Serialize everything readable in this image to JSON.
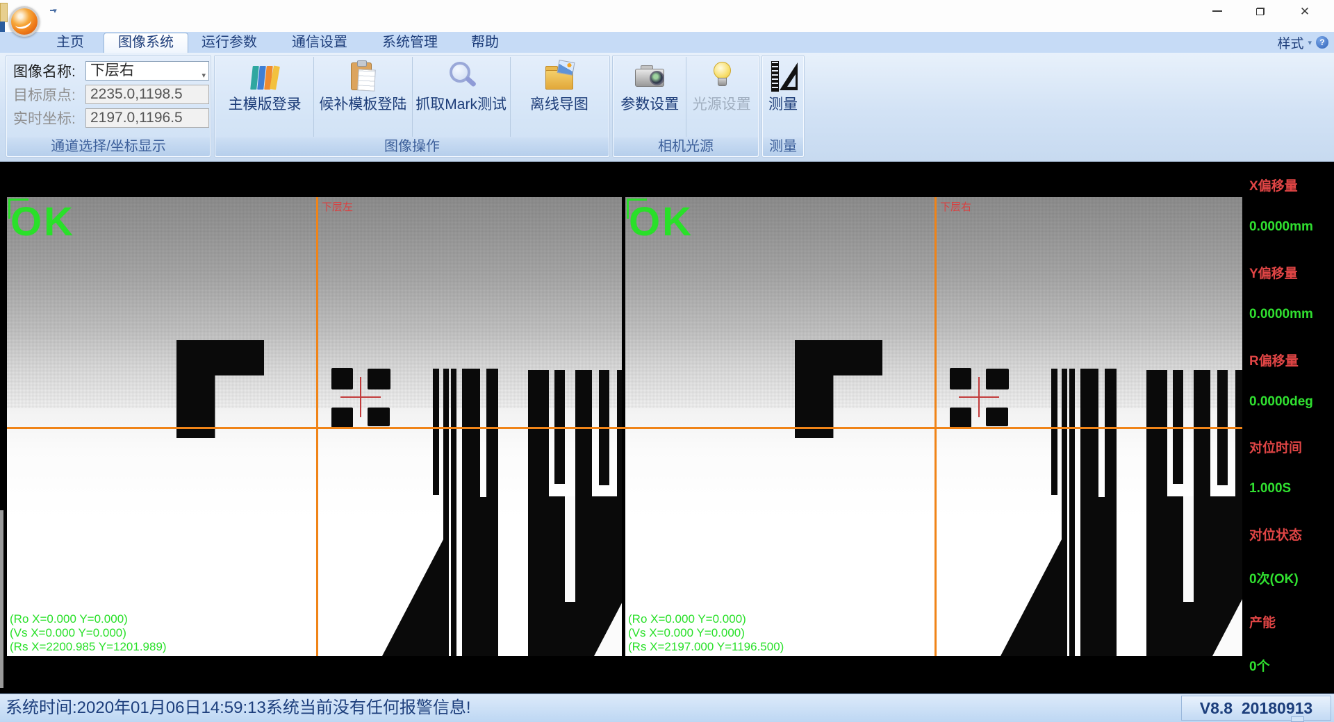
{
  "window": {
    "controls": {
      "close_glyph": "✕"
    }
  },
  "icons": {
    "dropdown": "▾",
    "help": "?"
  },
  "menu": {
    "tabs": [
      {
        "label": "主页",
        "active": false
      },
      {
        "label": "图像系统",
        "active": true
      },
      {
        "label": "运行参数",
        "active": false
      },
      {
        "label": "通信设置",
        "active": false
      },
      {
        "label": "系统管理",
        "active": false
      },
      {
        "label": "帮助",
        "active": false
      }
    ],
    "style_label": "样式"
  },
  "ribbon": {
    "channel": {
      "caption": "通道选择/坐标显示",
      "image_name_label": "图像名称:",
      "image_name_value": "下层右",
      "target_origin_label": "目标原点:",
      "target_origin_value": "2235.0,1198.5",
      "realtime_label": "实时坐标:",
      "realtime_value": "2197.0,1196.5"
    },
    "image_ops": {
      "caption": "图像操作",
      "buttons": [
        {
          "label": "主模版登录"
        },
        {
          "label": "候补模板登陆"
        },
        {
          "label": "抓取Mark测试"
        },
        {
          "label": "离线导图"
        }
      ]
    },
    "camera_light": {
      "caption": "相机光源",
      "buttons": [
        {
          "label": "参数设置",
          "disabled": false
        },
        {
          "label": "光源设置",
          "disabled": true
        }
      ]
    },
    "measure": {
      "caption": "测量",
      "buttons": [
        {
          "label": "测量"
        }
      ]
    }
  },
  "viewports": [
    {
      "result": "OK",
      "name": "下层左",
      "lines": [
        "(Ro X=0.000 Y=0.000)",
        "(Vs X=0.000 Y=0.000)",
        "(Rs X=2200.985 Y=1201.989)"
      ]
    },
    {
      "result": "OK",
      "name": "下层右",
      "lines": [
        "(Ro X=0.000 Y=0.000)",
        "(Vs X=0.000 Y=0.000)",
        "(Rs X=2197.000 Y=1196.500)"
      ]
    }
  ],
  "sidebar": {
    "items": [
      {
        "label": "X偏移量",
        "value": "0.0000mm"
      },
      {
        "label": "Y偏移量",
        "value": "0.0000mm"
      },
      {
        "label": "R偏移量",
        "value": "0.0000deg"
      },
      {
        "label": "对位时间",
        "value": "1.000S"
      },
      {
        "label": "对位状态",
        "value": "0次(OK)"
      },
      {
        "label": "产能",
        "value": "0个"
      }
    ]
  },
  "statusbar": {
    "message": "系统时间:2020年01月06日14:59:13系统当前没有任何报警信息!",
    "version": "V8.8  20180913"
  },
  "colors": {
    "accent_orange": "#f08418",
    "ok_green": "#29e029",
    "alert_red": "#e04545",
    "menu_text": "#1d3d7a"
  }
}
